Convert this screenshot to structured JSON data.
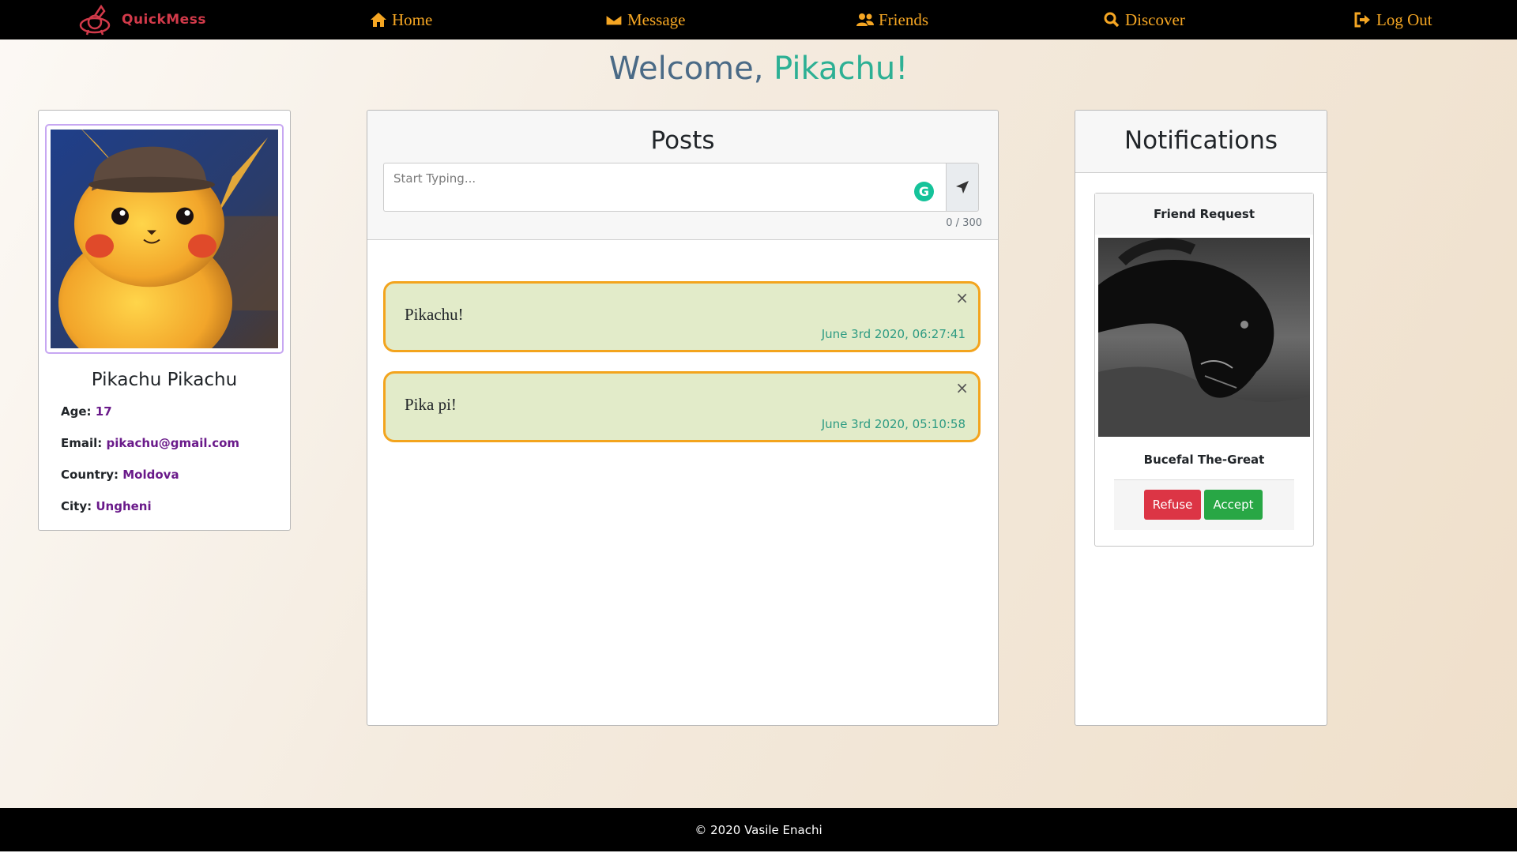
{
  "brand": {
    "name": "QuickMess"
  },
  "nav": {
    "home": "Home",
    "message": "Message",
    "friends": "Friends",
    "discover": "Discover",
    "logout": "Log Out"
  },
  "welcome": {
    "prefix": "Welcome,",
    "name": "Pikachu!"
  },
  "profile": {
    "full_name": "Pikachu Pikachu",
    "age_label": "Age:",
    "age": "17",
    "email_label": "Email:",
    "email": "pikachu@gmail.com",
    "country_label": "Country:",
    "country": "Moldova",
    "city_label": "City:",
    "city": "Ungheni"
  },
  "posts": {
    "title": "Posts",
    "input_placeholder": "Start Typing...",
    "char_counter": "0 / 300",
    "items": [
      {
        "text": "Pikachu!",
        "date": "June 3rd 2020, 06:27:41",
        "close": "×"
      },
      {
        "text": "Pika pi!",
        "date": "June 3rd 2020, 05:10:58",
        "close": "×"
      }
    ]
  },
  "notifications": {
    "title": "Notifications",
    "friend_request": {
      "heading": "Friend Request",
      "name": "Bucefal The-Great",
      "refuse": "Refuse",
      "accept": "Accept"
    }
  },
  "footer": {
    "text": "© 2020 Vasile Enachi"
  },
  "colors": {
    "nav_text": "#f5a623",
    "brand": "#d23a4a",
    "welcome_primary": "#4a6a86",
    "welcome_accent": "#2db094",
    "post_bg": "#e2ebc9",
    "post_border": "#f3a41d",
    "refuse": "#dc3545",
    "accept": "#28a745"
  },
  "icons": {
    "home": "home-icon",
    "message": "envelope-icon",
    "friends": "users-icon",
    "discover": "search-icon",
    "logout": "sign-out-icon",
    "send": "location-arrow-icon",
    "grammarly": "grammarly-icon",
    "close": "close-icon"
  }
}
